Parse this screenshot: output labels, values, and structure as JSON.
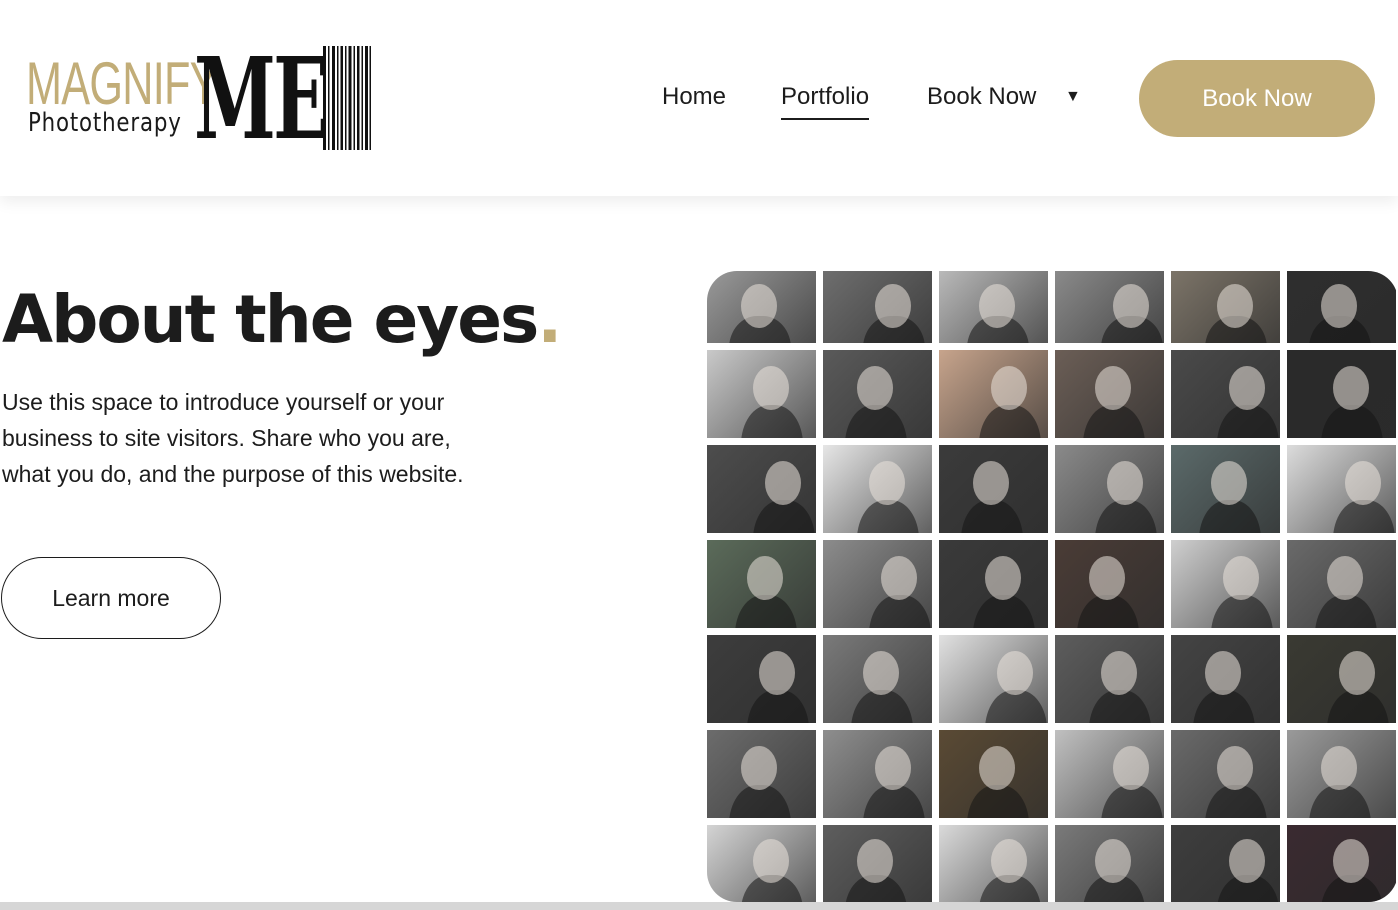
{
  "header": {
    "logo": {
      "magnify": "MAGNIFY",
      "phototherapy": "Phototherapy",
      "me": "ME"
    },
    "nav": {
      "home": "Home",
      "portfolio": "Portfolio",
      "book_now": "Book Now",
      "caret": "▼"
    },
    "cta_label": "Book Now"
  },
  "hero": {
    "title": "About the eyes",
    "title_dot": ".",
    "text": "Use this space to introduce yourself or your business to site visitors. Share who you are, what you do, and the purpose of this website.",
    "button_label": "Learn more"
  },
  "gallery": {
    "rows": 7,
    "cols": 6,
    "tones": [
      [
        "#9a9a9a",
        "#6e6e6e",
        "#b9b9b9",
        "#8a8a8a",
        "#7c7468",
        "#2e2e2e"
      ],
      [
        "#c9c9c9",
        "#5a5a5a",
        "#c7a48c",
        "#6b5e56",
        "#4a4a4a",
        "#2a2a2a"
      ],
      [
        "#4d4d4d",
        "#e6e6e6",
        "#3b3b3b",
        "#8a8a8a",
        "#5b6a6a",
        "#dcdcdc"
      ],
      [
        "#5b6b5a",
        "#8c8c8c",
        "#3a3a3a",
        "#4a3c36",
        "#cfcfcf",
        "#6a6a6a"
      ],
      [
        "#3d3d3d",
        "#7a7a7a",
        "#e1e1e1",
        "#5d5d5d",
        "#444444",
        "#3a3a32"
      ],
      [
        "#6c6c6c",
        "#8e8e8e",
        "#5a4a34",
        "#c0c0c0",
        "#6a6a6a",
        "#9a9a9a"
      ],
      [
        "#d4d4d4",
        "#5e5e5e",
        "#dadada",
        "#7a7a7a",
        "#3e3e3e",
        "#3a2a30"
      ]
    ]
  },
  "colors": {
    "accent": "#c2ad78",
    "text": "#1c1c1c",
    "background": "#ffffff"
  }
}
